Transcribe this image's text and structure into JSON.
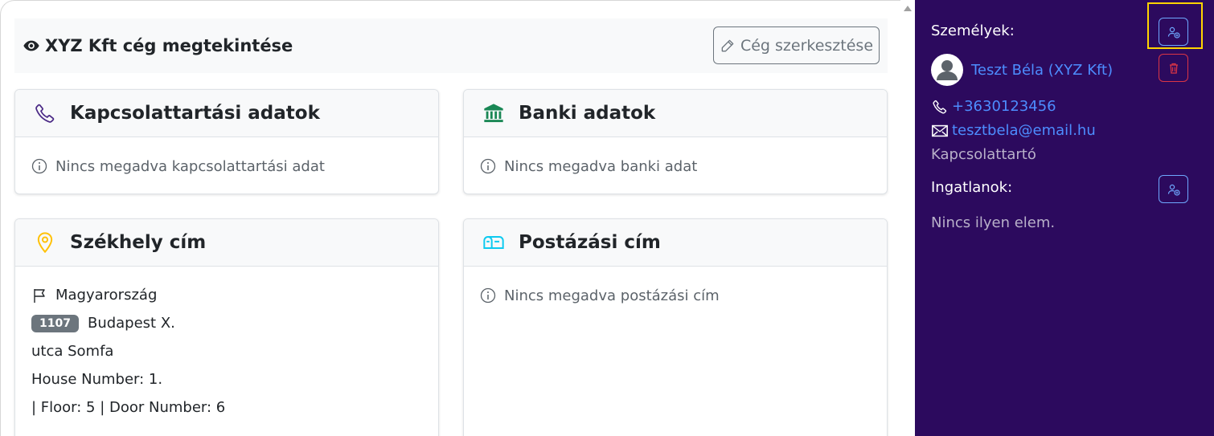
{
  "page": {
    "title": "XYZ Kft cég megtekintése",
    "edit_button_label": "Cég szerkesztése"
  },
  "cards": {
    "contact": {
      "title": "Kapcsolattartási adatok",
      "empty_text": "Nincs megadva kapcsolattartási adat",
      "icon": "phone-icon"
    },
    "bank": {
      "title": "Banki adatok",
      "empty_text": "Nincs megadva banki adat",
      "icon": "bank-icon"
    },
    "headquarters": {
      "title": "Székhely cím",
      "icon": "map-pin-icon",
      "country": "Magyarország",
      "zip": "1107",
      "city": "Budapest X.",
      "street": "utca Somfa",
      "house_number": "House Number: 1.",
      "floor_door": "| Floor: 5 | Door Number: 6"
    },
    "mailing": {
      "title": "Postázási cím",
      "empty_text": "Nincs megadva postázási cím",
      "icon": "mailbox-icon"
    }
  },
  "sidebar": {
    "persons_label": "Személyek:",
    "person": {
      "name": "Teszt Béla (XYZ Kft)",
      "phone": "+3630123456",
      "email": "tesztbela@email.hu",
      "role": "Kapcsolattartó"
    },
    "properties_label": "Ingatlanok:",
    "properties_empty": "Nincs ilyen elem."
  },
  "colors": {
    "sidebar_bg": "#2c0a5e",
    "link": "#4d8dff",
    "danger": "#dc3545",
    "highlight": "#ffd400",
    "contact_icon": "#4b2a86",
    "bank_icon": "#198754",
    "pin_icon": "#ffc107",
    "mailbox_icon": "#0dcaf0"
  }
}
